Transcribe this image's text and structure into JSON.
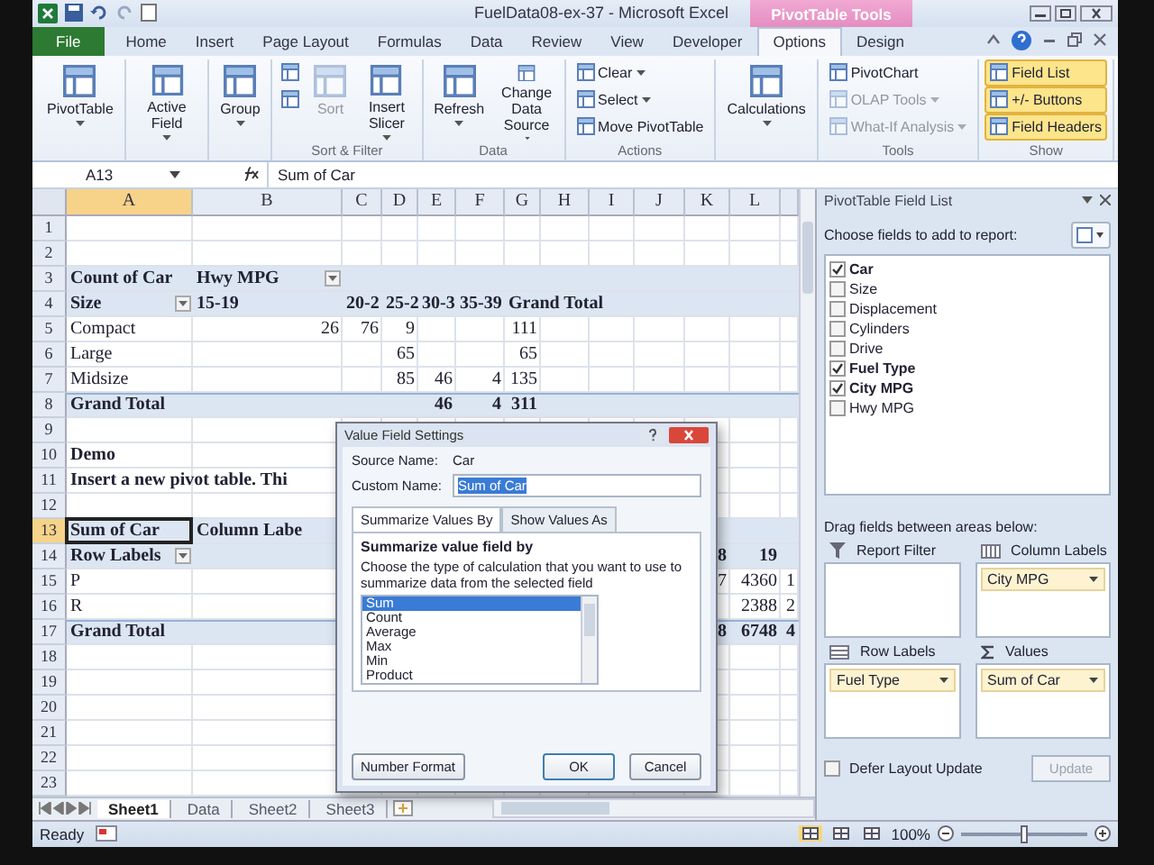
{
  "window": {
    "title": "FuelData08-ex-37 - Microsoft Excel",
    "context_label": "PivotTable Tools"
  },
  "tabs": [
    {
      "label": "File",
      "kind": "file",
      "selected": false
    },
    {
      "label": "Home",
      "kind": "tab",
      "selected": false
    },
    {
      "label": "Insert",
      "kind": "tab",
      "selected": false
    },
    {
      "label": "Page Layout",
      "kind": "tab",
      "selected": false
    },
    {
      "label": "Formulas",
      "kind": "tab",
      "selected": false
    },
    {
      "label": "Data",
      "kind": "tab",
      "selected": false
    },
    {
      "label": "Review",
      "kind": "tab",
      "selected": false
    },
    {
      "label": "View",
      "kind": "tab",
      "selected": false
    },
    {
      "label": "Developer",
      "kind": "tab",
      "selected": false
    },
    {
      "label": "Options",
      "kind": "tab",
      "selected": true
    },
    {
      "label": "Design",
      "kind": "tab",
      "selected": false
    }
  ],
  "ribbon": {
    "groups": [
      {
        "items": [
          {
            "kind": "large",
            "label": "PivotTable",
            "dropdown": true,
            "disabled": false,
            "on": false
          }
        ]
      },
      {
        "items": [
          {
            "kind": "large",
            "label": "Active Field",
            "dropdown": true,
            "disabled": false,
            "on": false
          }
        ]
      },
      {
        "items": [
          {
            "kind": "large",
            "label": "Group",
            "dropdown": true,
            "disabled": false,
            "on": false
          }
        ]
      },
      {
        "label": "Sort & Filter",
        "items": [
          {
            "kind": "icon",
            "dropdown": false,
            "disabled": false,
            "on": false
          },
          {
            "kind": "icon",
            "dropdown": false,
            "disabled": false,
            "on": false
          },
          {
            "kind": "large",
            "label": "Sort",
            "dropdown": false,
            "disabled": true,
            "on": false
          },
          {
            "kind": "large",
            "label": "Insert Slicer",
            "dropdown": true,
            "disabled": false,
            "on": false
          }
        ]
      },
      {
        "label": "Data",
        "items": [
          {
            "kind": "large",
            "label": "Refresh",
            "dropdown": true,
            "disabled": false,
            "on": false
          },
          {
            "kind": "large",
            "label": "Change Data Source",
            "dropdown": true,
            "disabled": false,
            "on": false
          }
        ]
      },
      {
        "label": "Actions",
        "items": [
          {
            "kind": "small",
            "label": "Clear",
            "dropdown": true,
            "disabled": false,
            "on": false
          },
          {
            "kind": "small",
            "label": "Select",
            "dropdown": true,
            "disabled": false,
            "on": false
          },
          {
            "kind": "small",
            "label": "Move PivotTable",
            "dropdown": false,
            "disabled": false,
            "on": false
          }
        ]
      },
      {
        "items": [
          {
            "kind": "large",
            "label": "Calculations",
            "dropdown": true,
            "disabled": false,
            "on": false
          }
        ]
      },
      {
        "label": "Tools",
        "items": [
          {
            "kind": "small",
            "label": "PivotChart",
            "dropdown": false,
            "disabled": false,
            "on": false
          },
          {
            "kind": "small",
            "label": "OLAP Tools",
            "dropdown": true,
            "disabled": true,
            "on": false
          },
          {
            "kind": "small",
            "label": "What-If Analysis",
            "dropdown": true,
            "disabled": true,
            "on": false
          }
        ]
      },
      {
        "label": "Show",
        "items": [
          {
            "kind": "small",
            "label": "Field List",
            "dropdown": false,
            "disabled": false,
            "on": true
          },
          {
            "kind": "small",
            "label": "+/- Buttons",
            "dropdown": false,
            "disabled": false,
            "on": true
          },
          {
            "kind": "small",
            "label": "Field Headers",
            "dropdown": false,
            "disabled": false,
            "on": true
          }
        ]
      }
    ]
  },
  "formula_bar": {
    "name_box": "A13",
    "value": "Sum of Car"
  },
  "grid": {
    "columns": [
      {
        "label": "A",
        "selected": true
      },
      {
        "label": "B",
        "selected": false
      },
      {
        "label": "C",
        "selected": false
      },
      {
        "label": "D",
        "selected": false
      },
      {
        "label": "E",
        "selected": false
      },
      {
        "label": "F",
        "selected": false
      },
      {
        "label": "G",
        "selected": false
      },
      {
        "label": "H",
        "selected": false
      },
      {
        "label": "I",
        "selected": false
      },
      {
        "label": "J",
        "selected": false
      },
      {
        "label": "K",
        "selected": false
      },
      {
        "label": "L",
        "selected": false
      }
    ],
    "rows": [
      {
        "label": "1",
        "kind": "plain",
        "selected": false
      },
      {
        "label": "2",
        "kind": "plain",
        "selected": false
      },
      {
        "label": "3",
        "kind": "header",
        "selected": false,
        "cells": [
          {
            "text": "Count of Car",
            "kind": "text",
            "dropdown": false
          },
          {
            "text": "Hwy MPG",
            "kind": "text",
            "dropdown": true
          }
        ]
      },
      {
        "label": "4",
        "kind": "header",
        "selected": false,
        "cells": [
          {
            "text": "Size",
            "kind": "text",
            "dropdown": true
          },
          {
            "text": "15-19",
            "kind": "text",
            "dropdown": false
          },
          {
            "text": "20-2",
            "kind": "text",
            "dropdown": false
          },
          {
            "text": "25-2",
            "kind": "text",
            "dropdown": false
          },
          {
            "text": "30-3",
            "kind": "text",
            "dropdown": false
          },
          {
            "text": "35-39",
            "kind": "text",
            "dropdown": false
          },
          {
            "text": "Grand Total",
            "kind": "text",
            "dropdown": false
          }
        ]
      },
      {
        "label": "5",
        "kind": "plain",
        "selected": false,
        "cells": [
          {
            "text": "Compact",
            "kind": "text",
            "dropdown": false
          },
          {
            "text": "26",
            "kind": "number",
            "dropdown": false
          },
          {
            "text": "76",
            "kind": "number",
            "dropdown": false
          },
          {
            "text": "9",
            "kind": "number",
            "dropdown": false
          },
          null,
          null,
          {
            "text": "111",
            "kind": "number",
            "dropdown": false
          }
        ]
      },
      {
        "label": "6",
        "kind": "plain",
        "selected": false,
        "cells": [
          {
            "text": "Large",
            "kind": "text",
            "dropdown": false
          },
          null,
          null,
          {
            "text": "65",
            "kind": "number",
            "dropdown": false
          },
          null,
          null,
          {
            "text": "65",
            "kind": "number",
            "dropdown": false
          }
        ]
      },
      {
        "label": "7",
        "kind": "plain",
        "selected": false,
        "cells": [
          {
            "text": "Midsize",
            "kind": "text",
            "dropdown": false
          },
          null,
          null,
          {
            "text": "85",
            "kind": "number",
            "dropdown": false
          },
          {
            "text": "46",
            "kind": "number",
            "dropdown": false
          },
          {
            "text": "4",
            "kind": "number",
            "dropdown": false
          },
          {
            "text": "135",
            "kind": "number",
            "dropdown": false
          }
        ]
      },
      {
        "label": "8",
        "kind": "total",
        "selected": false,
        "cells": [
          {
            "text": "Grand Total",
            "kind": "text",
            "dropdown": false
          },
          null,
          null,
          null,
          {
            "text": "46",
            "kind": "number",
            "dropdown": false
          },
          {
            "text": "4",
            "kind": "number",
            "dropdown": false
          },
          {
            "text": "311",
            "kind": "number",
            "dropdown": false
          }
        ]
      },
      {
        "label": "9",
        "kind": "plain",
        "selected": false
      },
      {
        "label": "10",
        "kind": "note",
        "selected": false,
        "cells": [
          {
            "text": "Demo",
            "kind": "text",
            "dropdown": false
          }
        ]
      },
      {
        "label": "11",
        "kind": "note",
        "selected": false,
        "cells": [
          {
            "text": "Insert a new pivot table. Thi",
            "kind": "text",
            "dropdown": false
          }
        ]
      },
      {
        "label": "12",
        "kind": "plain",
        "selected": false
      },
      {
        "label": "13",
        "kind": "header",
        "selected": true,
        "cells": [
          {
            "text": "Sum of Car",
            "kind": "text",
            "dropdown": false
          },
          {
            "text": "Column Labe",
            "kind": "text",
            "dropdown": false
          }
        ]
      },
      {
        "label": "14",
        "kind": "header",
        "selected": false,
        "cells": [
          {
            "text": "Row Labels",
            "kind": "text",
            "dropdown": true
          },
          null,
          null,
          null,
          null,
          null,
          null,
          null,
          null,
          null,
          {
            "text": "8",
            "kind": "number",
            "dropdown": false
          },
          {
            "text": "19",
            "kind": "number",
            "dropdown": false
          }
        ]
      },
      {
        "label": "15",
        "kind": "plain",
        "selected": false,
        "cells": [
          {
            "text": "P",
            "kind": "text",
            "dropdown": false
          },
          null,
          null,
          null,
          null,
          null,
          null,
          null,
          null,
          null,
          {
            "text": "7",
            "kind": "number",
            "dropdown": false
          },
          {
            "text": "4360",
            "kind": "number",
            "dropdown": false
          },
          {
            "text": "1",
            "kind": "number",
            "dropdown": false
          }
        ]
      },
      {
        "label": "16",
        "kind": "plain",
        "selected": false,
        "cells": [
          {
            "text": "R",
            "kind": "text",
            "dropdown": false
          },
          null,
          null,
          null,
          null,
          null,
          null,
          null,
          null,
          null,
          null,
          {
            "text": "2388",
            "kind": "number",
            "dropdown": false
          },
          {
            "text": "2",
            "kind": "number",
            "dropdown": false
          }
        ]
      },
      {
        "label": "17",
        "kind": "total",
        "selected": false,
        "cells": [
          {
            "text": "Grand Total",
            "kind": "text",
            "dropdown": false
          },
          null,
          null,
          null,
          null,
          null,
          null,
          null,
          null,
          null,
          {
            "text": "8",
            "kind": "number",
            "dropdown": false
          },
          {
            "text": "6748",
            "kind": "number",
            "dropdown": false
          },
          {
            "text": "4",
            "kind": "number",
            "dropdown": false
          }
        ]
      },
      {
        "label": "18",
        "kind": "plain",
        "selected": false
      },
      {
        "label": "19",
        "kind": "plain",
        "selected": false
      },
      {
        "label": "20",
        "kind": "plain",
        "selected": false
      },
      {
        "label": "21",
        "kind": "plain",
        "selected": false
      },
      {
        "label": "22",
        "kind": "plain",
        "selected": false
      },
      {
        "label": "23",
        "kind": "plain",
        "selected": false
      }
    ]
  },
  "sheet_tabs": [
    {
      "label": "Sheet1",
      "selected": true
    },
    {
      "label": "Data",
      "selected": false
    },
    {
      "label": "Sheet2",
      "selected": false
    },
    {
      "label": "Sheet3",
      "selected": false
    }
  ],
  "dialog": {
    "title": "Value Field Settings",
    "source_label": "Source Name:",
    "source_value": "Car",
    "custom_label": "Custom Name:",
    "custom_value": "Sum of Car",
    "tabs": [
      {
        "label": "Summarize Values By",
        "selected": true
      },
      {
        "label": "Show Values As",
        "selected": false
      }
    ],
    "heading": "Summarize value field by",
    "description": "Choose the type of calculation that you want to use to summarize data from the selected field",
    "options": [
      {
        "label": "Sum",
        "selected": true
      },
      {
        "label": "Count",
        "selected": false
      },
      {
        "label": "Average",
        "selected": false
      },
      {
        "label": "Max",
        "selected": false
      },
      {
        "label": "Min",
        "selected": false
      },
      {
        "label": "Product",
        "selected": false
      }
    ],
    "buttons": [
      {
        "label": "Number Format",
        "kind": "secondary"
      },
      {
        "label": "OK",
        "kind": "default"
      },
      {
        "label": "Cancel",
        "kind": "secondary"
      }
    ]
  },
  "field_list": {
    "title": "PivotTable Field List",
    "prompt": "Choose fields to add to report:",
    "fields": [
      {
        "label": "Car",
        "checked": true
      },
      {
        "label": "Size",
        "checked": false
      },
      {
        "label": "Displacement",
        "checked": false
      },
      {
        "label": "Cylinders",
        "checked": false
      },
      {
        "label": "Drive",
        "checked": false
      },
      {
        "label": "Fuel Type",
        "checked": true
      },
      {
        "label": "City MPG",
        "checked": true
      },
      {
        "label": "Hwy MPG",
        "checked": false
      }
    ],
    "areas_prompt": "Drag fields between areas below:",
    "areas": [
      {
        "kind": "filter",
        "label": "Report Filter"
      },
      {
        "kind": "columns",
        "label": "Column Labels",
        "items": [
          "City MPG"
        ]
      },
      {
        "kind": "rows",
        "label": "Row Labels",
        "items": [
          "Fuel Type"
        ]
      },
      {
        "kind": "values",
        "label": "Values",
        "items": [
          "Sum of Car"
        ]
      }
    ],
    "defer": {
      "label": "Defer Layout Update",
      "checked": false
    },
    "update_button": {
      "label": "Update",
      "disabled": true
    }
  },
  "status_bar": {
    "status": "Ready",
    "views": [
      {
        "selected": true
      },
      {
        "selected": false
      },
      {
        "selected": false
      }
    ],
    "zoom": "100%",
    "zoom_slider": {
      "level": 0.5
    }
  }
}
